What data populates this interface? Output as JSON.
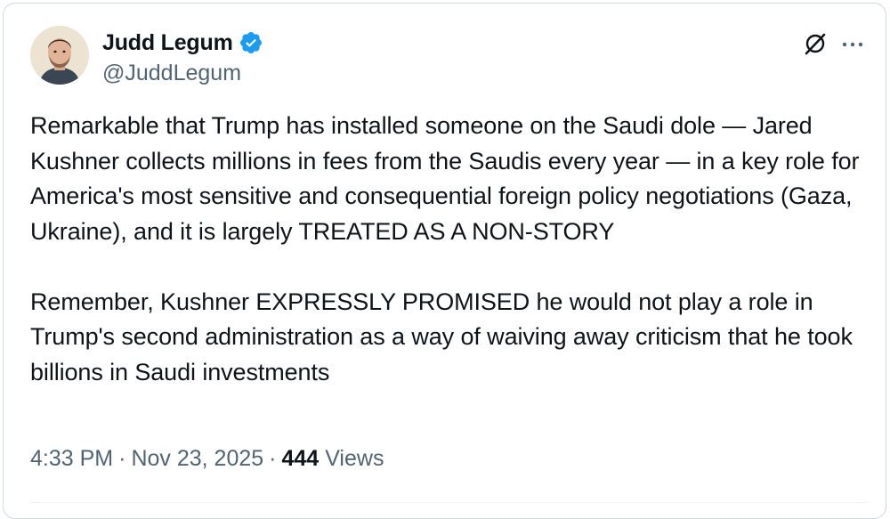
{
  "author": {
    "display_name": "Judd Legum",
    "handle": "@JuddLegum",
    "verified": true,
    "badge_color": "#1d9bf0"
  },
  "icons": {
    "grok": "grok-icon",
    "more": "more-options-icon",
    "verified": "verified-badge-icon"
  },
  "tweet": {
    "paragraph_1": "Remarkable that Trump has installed someone on the Saudi dole — Jared Kushner collects millions in fees from the Saudis every year — in a key role for America's most sensitive and consequential foreign policy negotiations (Gaza, Ukraine), and it is largely TREATED AS A NON-STORY",
    "paragraph_2": "Remember, Kushner EXPRESSLY PROMISED he would not play a role in Trump's second administration as a way of waiving away criticism that he took billions in Saudi investments"
  },
  "meta": {
    "time": "4:33 PM",
    "date": "Nov 23, 2025",
    "separator": "·",
    "views_count": "444",
    "views_label": "Views"
  },
  "colors": {
    "text_primary": "#0f1419",
    "text_secondary": "#536471",
    "border": "#cfd9de"
  }
}
